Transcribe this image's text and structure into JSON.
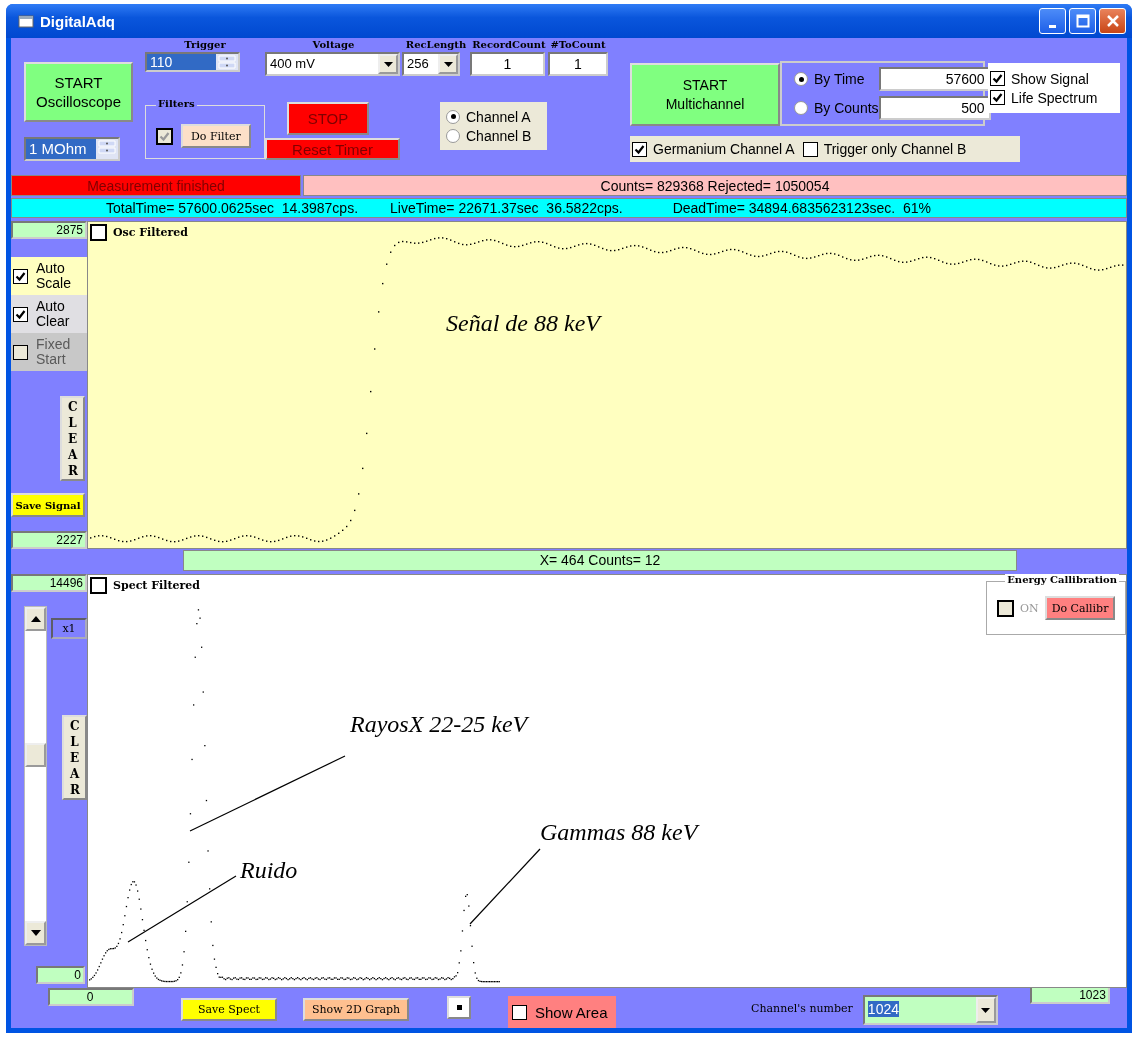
{
  "window": {
    "title": "DigitalAdq"
  },
  "oscilloscope_start": {
    "label": "START Oscilloscope"
  },
  "impedance": {
    "value": "1 MOhm"
  },
  "trigger": {
    "label": "Trigger",
    "value": "110"
  },
  "filters": {
    "title": "Filters",
    "checked": true,
    "disabled": true,
    "button": "Do Filter"
  },
  "voltage": {
    "label": "Voltage",
    "value": "400 mV"
  },
  "rec_length": {
    "label": "RecLength",
    "value": "256"
  },
  "record_count": {
    "label": "RecordCount",
    "value": "1"
  },
  "to_count": {
    "label": "#ToCount",
    "value": "1"
  },
  "stop_button": "STOP",
  "reset_timer_button": "Reset Timer",
  "channels": [
    {
      "label": "Channel A",
      "selected": true
    },
    {
      "label": "Channel B",
      "selected": false
    }
  ],
  "multichannel_start": {
    "label": "START Multichannel"
  },
  "stop_modes": [
    {
      "label": "By Time",
      "selected": true,
      "value": "57600"
    },
    {
      "label": "By Counts",
      "selected": false,
      "value": "500"
    }
  ],
  "display_options": [
    {
      "label": "Show Signal",
      "checked": true
    },
    {
      "label": "Life Spectrum",
      "checked": true
    }
  ],
  "channel_options": [
    {
      "label": "Germanium Channel A",
      "checked": true
    },
    {
      "label": "Trigger only Channel B",
      "checked": false
    }
  ],
  "status": {
    "message": "Measurement finished",
    "counts": "Counts= 829368 Rejected= 1050054"
  },
  "times": [
    "TotalTime= 57600.0625sec  14.3987cps.",
    "LiveTime= 22671.37sec  36.5822cps.",
    "DeadTime= 34894.6835623123sec.  61%"
  ],
  "oscilloscope": {
    "max": "2875",
    "min": "2227",
    "filter": {
      "label": "Osc Filtered",
      "checked": false
    },
    "options": [
      {
        "label": "Auto Scale",
        "checked": true,
        "disabled": false
      },
      {
        "label": "Auto Clear",
        "checked": true,
        "disabled": false
      },
      {
        "label": "Fixed Start",
        "checked": false,
        "disabled": true
      }
    ],
    "clear_button": "CLEAR",
    "save_button": "Save Signal",
    "annotation": "Señal de 88 keV"
  },
  "cursor": {
    "readout": "X= 464 Counts= 12"
  },
  "spectrum": {
    "max": "14496",
    "min": "0",
    "filter": {
      "label": "Spect Filtered",
      "checked": false
    },
    "zoom": "x1",
    "clear_button": "CLEAR",
    "annotations": [
      {
        "text": "RayosX 22-25  keV"
      },
      {
        "text": "Ruido"
      },
      {
        "text": "Gammas 88 keV"
      }
    ],
    "calibration": {
      "title": "Energy Callibration",
      "on": false,
      "label": "ON",
      "button": "Do Callibr"
    },
    "x_min": "0",
    "x_max": "1023",
    "save_button": "Save Spect",
    "graph_button": "Show 2D Graph",
    "show_area": {
      "label": "Show Area",
      "checked": false
    },
    "channels_label": "Channel's number",
    "channels_value": "1024"
  }
}
